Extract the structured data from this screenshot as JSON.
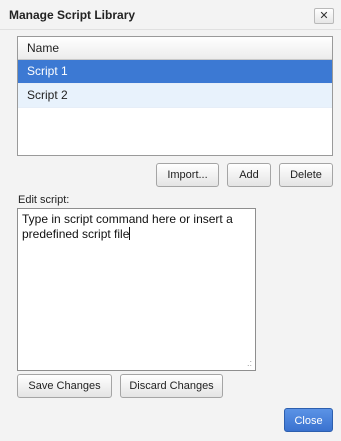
{
  "dialog": {
    "title": "Manage Script Library",
    "close_glyph": "✕"
  },
  "script_list": {
    "header": "Name",
    "items": [
      {
        "label": "Script 1",
        "selected": true
      },
      {
        "label": "Script 2",
        "selected": false
      }
    ]
  },
  "list_actions": {
    "import_label": "Import...",
    "add_label": "Add",
    "delete_label": "Delete"
  },
  "editor": {
    "label": "Edit script:",
    "value": "Type in script command here or insert a predefined script file"
  },
  "editor_actions": {
    "save_label": "Save Changes",
    "discard_label": "Discard Changes"
  },
  "footer": {
    "close_label": "Close"
  },
  "colors": {
    "selection": "#3c79d3",
    "alt_row": "#e8f2fc",
    "primary_button": "#3a72cf"
  }
}
